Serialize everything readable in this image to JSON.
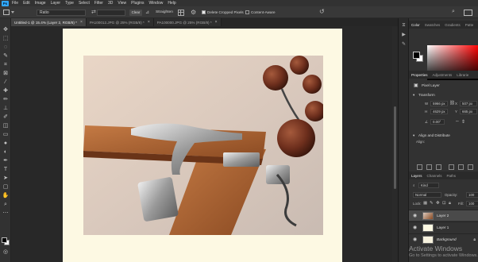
{
  "menu": [
    "File",
    "Edit",
    "Image",
    "Layer",
    "Type",
    "Select",
    "Filter",
    "3D",
    "View",
    "Plugins",
    "Window",
    "Help"
  ],
  "options": {
    "ratio": "Ratio",
    "clear": "Clear",
    "straighten": "Straighten",
    "delete_cropped": "Delete Cropped Pixels",
    "content_aware": "Content-Aware"
  },
  "tabs": [
    {
      "label": "Untitled-1 @ 15.4% (Layer 2, RGB/8) *",
      "active": true
    },
    {
      "label": "PA100012.JPG @ 25% (RGB/8) *",
      "active": false
    },
    {
      "label": "PA100000.JPG @ 25% (RGB/8) *",
      "active": false
    }
  ],
  "tools": [
    "move",
    "artboard",
    "marquee",
    "lasso",
    "quick-select",
    "crop",
    "frame",
    "eyedropper",
    "healing",
    "brush",
    "clone-stamp",
    "history-brush",
    "eraser",
    "gradient",
    "blur",
    "dodge",
    "pen",
    "type",
    "path-select",
    "rectangle",
    "hand",
    "zoom",
    "more"
  ],
  "colors": {
    "foreground": "#000000",
    "background": "#ffffff",
    "accent": "#31a8ff",
    "canvas": "#fdf9e3"
  },
  "panels": {
    "color_tabs": [
      "Color",
      "Swatches",
      "Gradients",
      "Patte"
    ],
    "prop_tabs": [
      "Properties",
      "Adjustments",
      "Librarie"
    ],
    "pixel_layer": "Pixel Layer",
    "transform": "Transform",
    "w": "5966 px",
    "h": "4629 px",
    "x": "507 px",
    "y": "665 px",
    "angle": "0.00°",
    "align": "Align and Distribute",
    "align_label": "Align:",
    "layer_tabs": [
      "Layers",
      "Channels",
      "Paths"
    ],
    "kind": "Kind",
    "blend": "Normal",
    "opacity_label": "Opacity:",
    "opacity": "100",
    "lock_label": "Lock:",
    "fill_label": "Fill:",
    "fill": "100",
    "layers": [
      {
        "name": "Layer 2",
        "selected": true,
        "italic": false
      },
      {
        "name": "Layer 1",
        "selected": false,
        "italic": false
      },
      {
        "name": "Background",
        "selected": false,
        "italic": true
      }
    ]
  },
  "watermark": {
    "title": "Activate Windows",
    "subtitle": "Go to Settings to activate Windows."
  }
}
